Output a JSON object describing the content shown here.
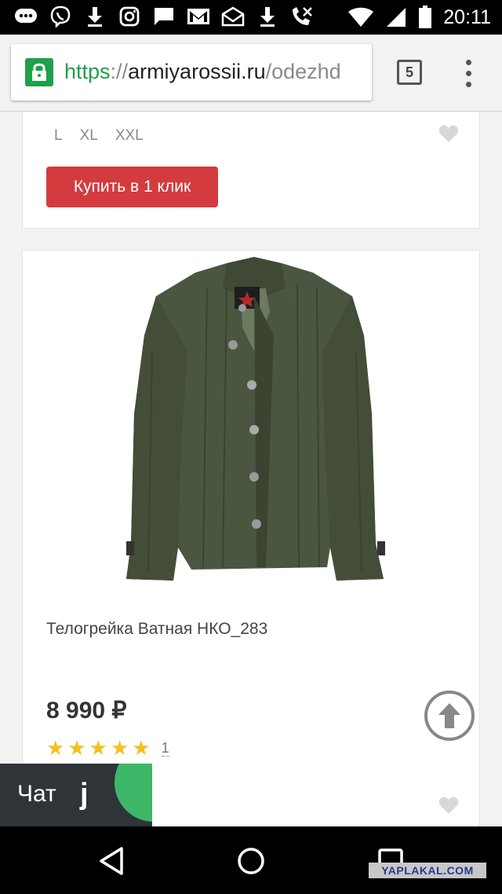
{
  "status_bar": {
    "time": "20:11",
    "icons_left": [
      "messages-icon",
      "viber-icon",
      "download-icon",
      "instagram-icon",
      "chat-bubble-icon",
      "gmail-icon",
      "mail-icon",
      "download-icon",
      "missed-call-icon"
    ],
    "icons_right": [
      "wifi-icon",
      "signal-icon",
      "battery-icon"
    ]
  },
  "browser": {
    "url_scheme": "https",
    "url_sep": "://",
    "url_host": "armiyarossii.ru",
    "url_path": "/odezhd",
    "tab_count": "5"
  },
  "top_card": {
    "sizes": [
      "L",
      "XL",
      "XXL"
    ],
    "buy_label": "Купить в 1 клик"
  },
  "product": {
    "title": "Телогрейка Ватная НКО_283",
    "price": "8 990 ₽",
    "rating": 5,
    "rating_count": "1"
  },
  "chat": {
    "label": "Чат",
    "logo_letter": "j"
  },
  "watermark": "YAPLAKAL.COM",
  "colors": {
    "buy_button": "#d33b3f",
    "https_green": "#1fa04a",
    "star": "#f3c11b",
    "chat_bg": "#2f3438",
    "chat_green": "#3cb768"
  }
}
